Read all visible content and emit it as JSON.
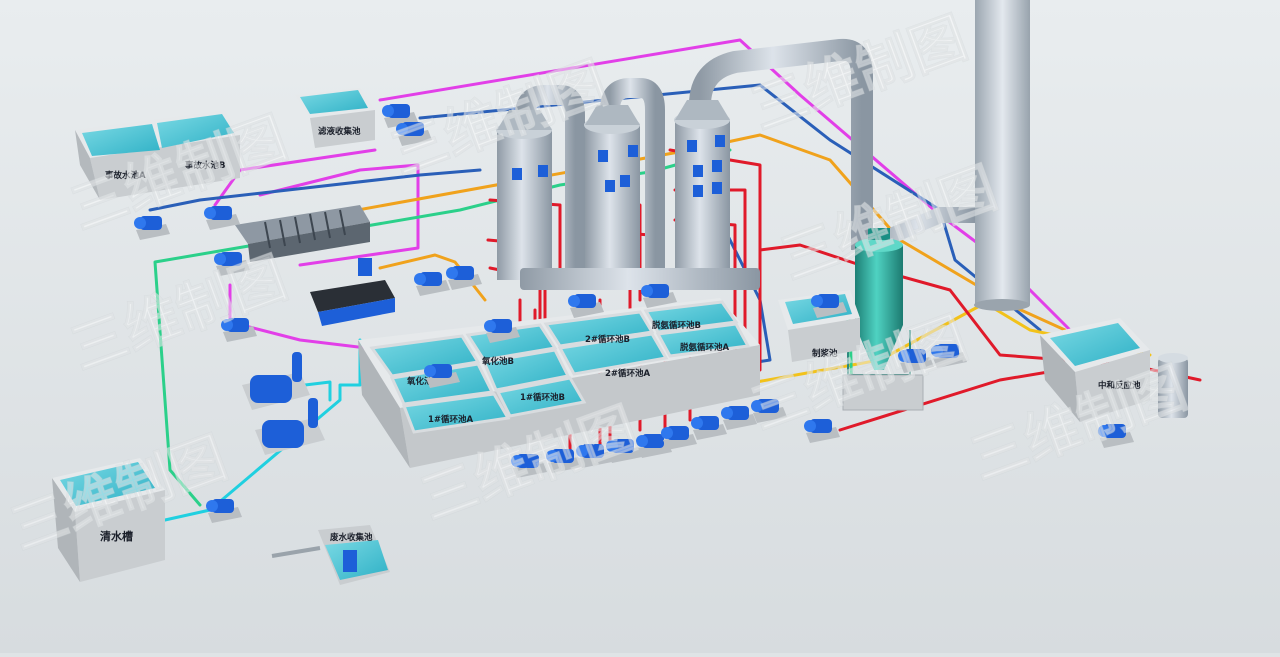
{
  "labels": {
    "accident_pool_a": "事故水池A",
    "accident_pool_b": "事故水池B",
    "leak_collect_pool": "滤液收集池",
    "oxidation_pool": "氧化池A",
    "oxidation_pool_b": "氧化池B",
    "circ_pool_1a": "1#循环池A",
    "circ_pool_1b": "1#循环池B",
    "circ_pool_2a": "2#循环池A",
    "circ_pool_2b": "2#循环池B",
    "desulf_circ_a": "脱氨循环池A",
    "desulf_circ_b": "脱氨循环池B",
    "slurry_pool": "制浆池",
    "neutralization_pool": "中和反应池",
    "clean_water_tank": "清水槽",
    "sump_pit": "废水收集池"
  },
  "watermark": "三维制图",
  "colors": {
    "pipe_magenta": "#e23fe8",
    "pipe_blue": "#2a5fb8",
    "pipe_orange": "#f0a21c",
    "pipe_red": "#e01a2a",
    "pipe_green": "#2bd08a",
    "pipe_cyan": "#20d0e0",
    "pipe_yellow": "#f2c21a",
    "pump_blue": "#1d5fd8",
    "concrete": "#c9cdd0",
    "water": "#4cc6d6",
    "tower_gray": "#b7c2cc",
    "settler_teal": "#2aa79a"
  }
}
